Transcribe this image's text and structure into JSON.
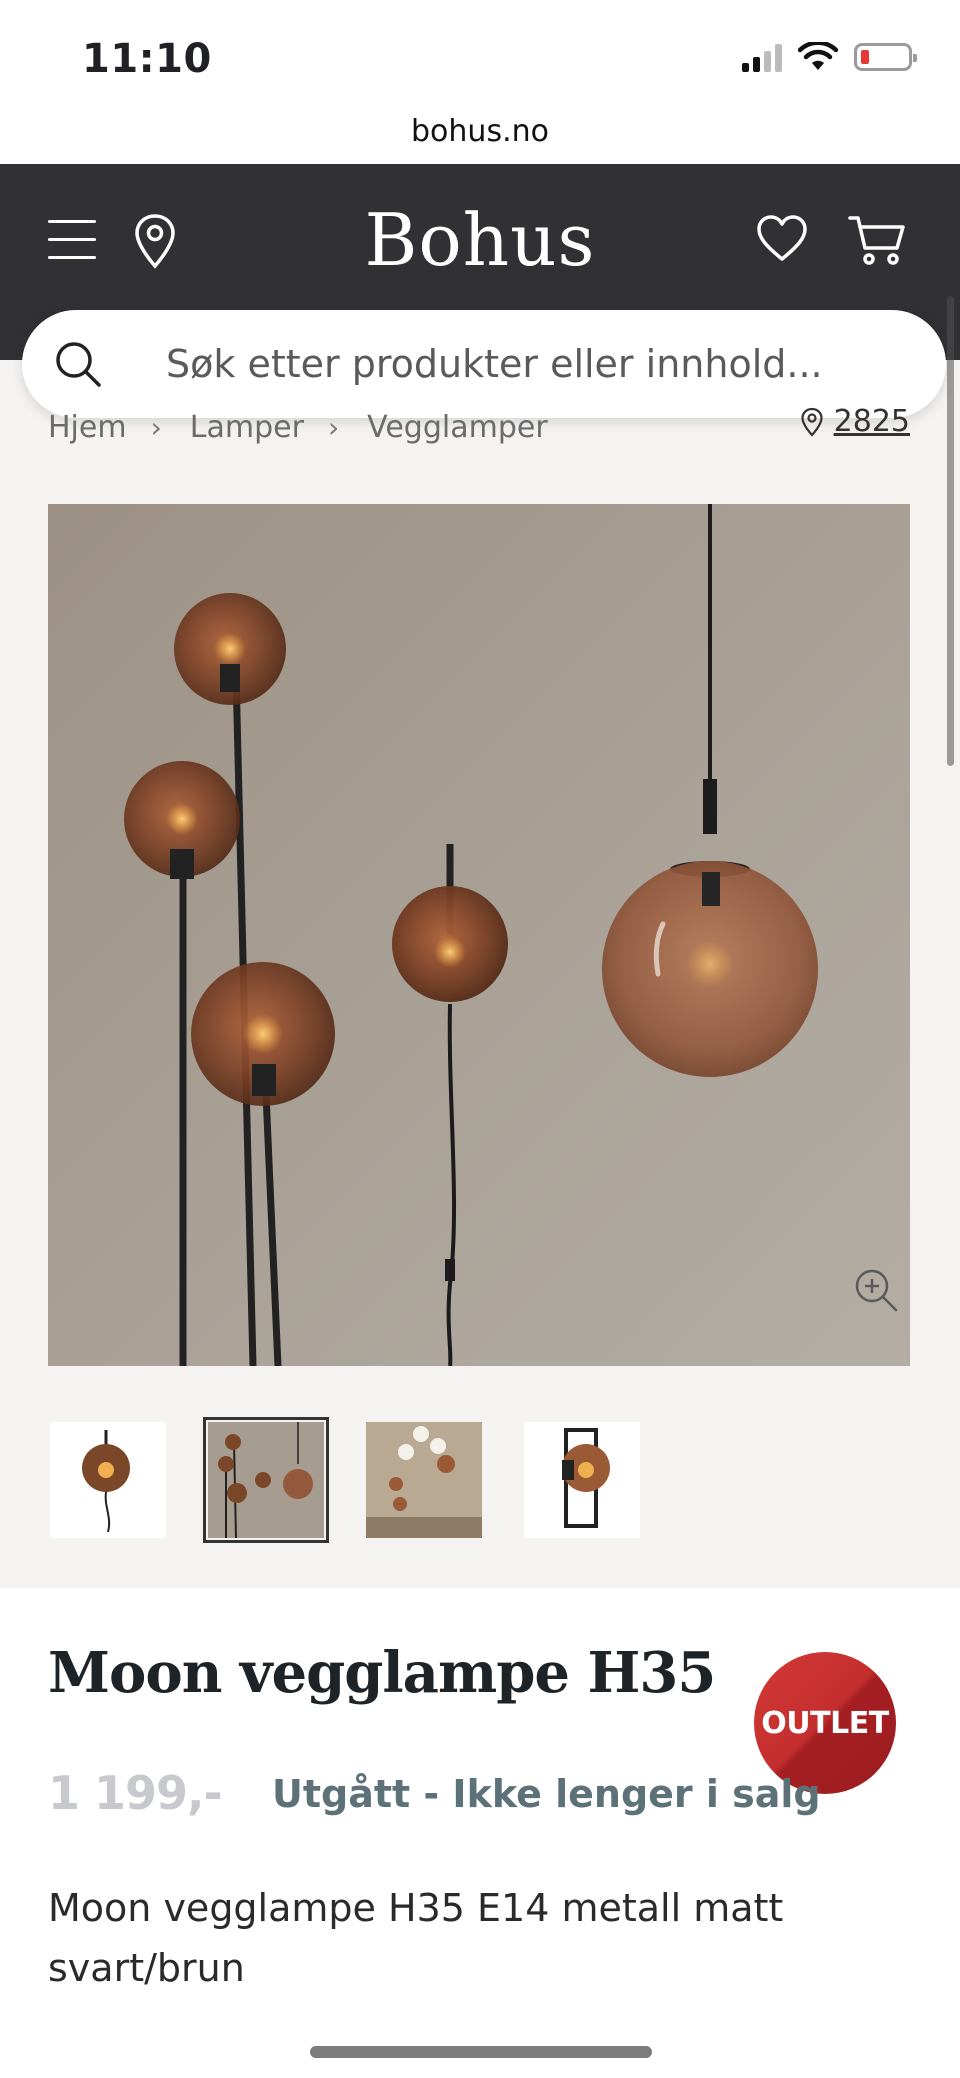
{
  "status_bar": {
    "time": "11:10"
  },
  "browser": {
    "url": "bohus.no"
  },
  "header": {
    "logo": "Bohus"
  },
  "search": {
    "placeholder": "Søk etter produkter eller innhold..."
  },
  "breadcrumb": {
    "items": [
      "Hjem",
      "Lamper",
      "Vegglamper"
    ],
    "store_number": "2825"
  },
  "gallery": {
    "thumbnail_count": 4,
    "active_thumbnail": 2
  },
  "product": {
    "title": "Moon vegglampe H35",
    "badge": "OUTLET",
    "price": "1 199,-",
    "availability": "Utgått - Ikke lenger i salg",
    "description": "Moon vegglampe H35 E14 metall matt svart/brun"
  },
  "colors": {
    "header_bg": "#313135",
    "badge_red": "#c42e2e",
    "status_text": "#5d7179",
    "price_text": "#c7c9cc"
  }
}
